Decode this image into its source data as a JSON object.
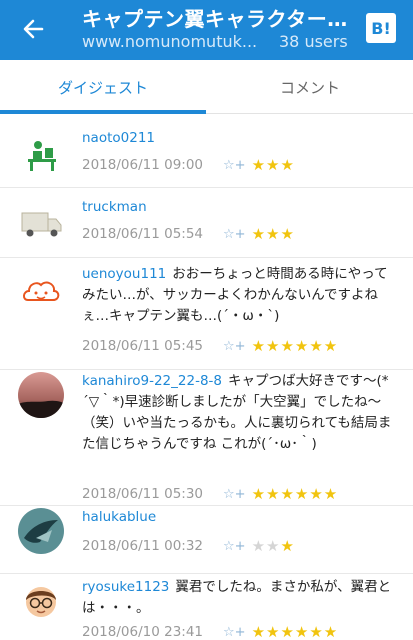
{
  "header": {
    "title": "キャプテン翼キャラクター診断",
    "domain": "www.nomunomutuk...",
    "users": "38 users",
    "logo": "B!"
  },
  "tabs": [
    {
      "label": "ダイジェスト",
      "active": true
    },
    {
      "label": "コメント",
      "active": false
    }
  ],
  "accent_color": "#1e88d6",
  "star_color": "#f1c40f",
  "comments": [
    {
      "user": "naoto0211",
      "text": "",
      "date": "2018/06/11 09:00",
      "add_star_icon": "☆+",
      "stars": 3,
      "stars_text": "★★★",
      "gray_stars_text": "",
      "avatar_icon": "desk-person-icon"
    },
    {
      "user": "truckman",
      "text": "",
      "date": "2018/06/11 05:54",
      "add_star_icon": "☆+",
      "stars": 3,
      "stars_text": "★★★",
      "gray_stars_text": "",
      "avatar_icon": "truck-icon"
    },
    {
      "user": "uenoyou111",
      "text": "おおーちょっと時間ある時にやってみたい…が、サッカーよくわかんないんですよねぇ…キャプテン翼も…(´・ω・`)",
      "date": "2018/06/11 05:45",
      "add_star_icon": "☆+",
      "stars": 6,
      "stars_text": "★★★★★★",
      "gray_stars_text": "",
      "avatar_icon": "orange-face-icon"
    },
    {
      "user": "kanahiro9-22_22-8-8",
      "text": "キャプつば大好きです〜(*´▽｀*)早速診断しましたが「大空翼」でしたね〜（笑）いや当たっるかも。人に裏切られても結局また信じちゃうんですね これが(´･ω･｀)",
      "date": "2018/06/11 05:30",
      "add_star_icon": "☆+",
      "stars": 6,
      "stars_text": "★★★★★★",
      "gray_stars_text": "",
      "avatar_icon": "sunset-photo-icon"
    },
    {
      "user": "halukablue",
      "text": "",
      "date": "2018/06/11 00:32",
      "add_star_icon": "☆+",
      "stars": 1,
      "stars_text": "★",
      "gray_stars_text": "★★",
      "avatar_icon": "bird-photo-icon"
    },
    {
      "user": "ryosuke1123",
      "text": "翼君でしたね。まさか私が、翼君とは・・・。",
      "date": "2018/06/10 23:41",
      "add_star_icon": "☆+",
      "stars": 6,
      "stars_text": "★★★★★★",
      "gray_stars_text": "",
      "avatar_icon": "glasses-boy-icon"
    }
  ]
}
